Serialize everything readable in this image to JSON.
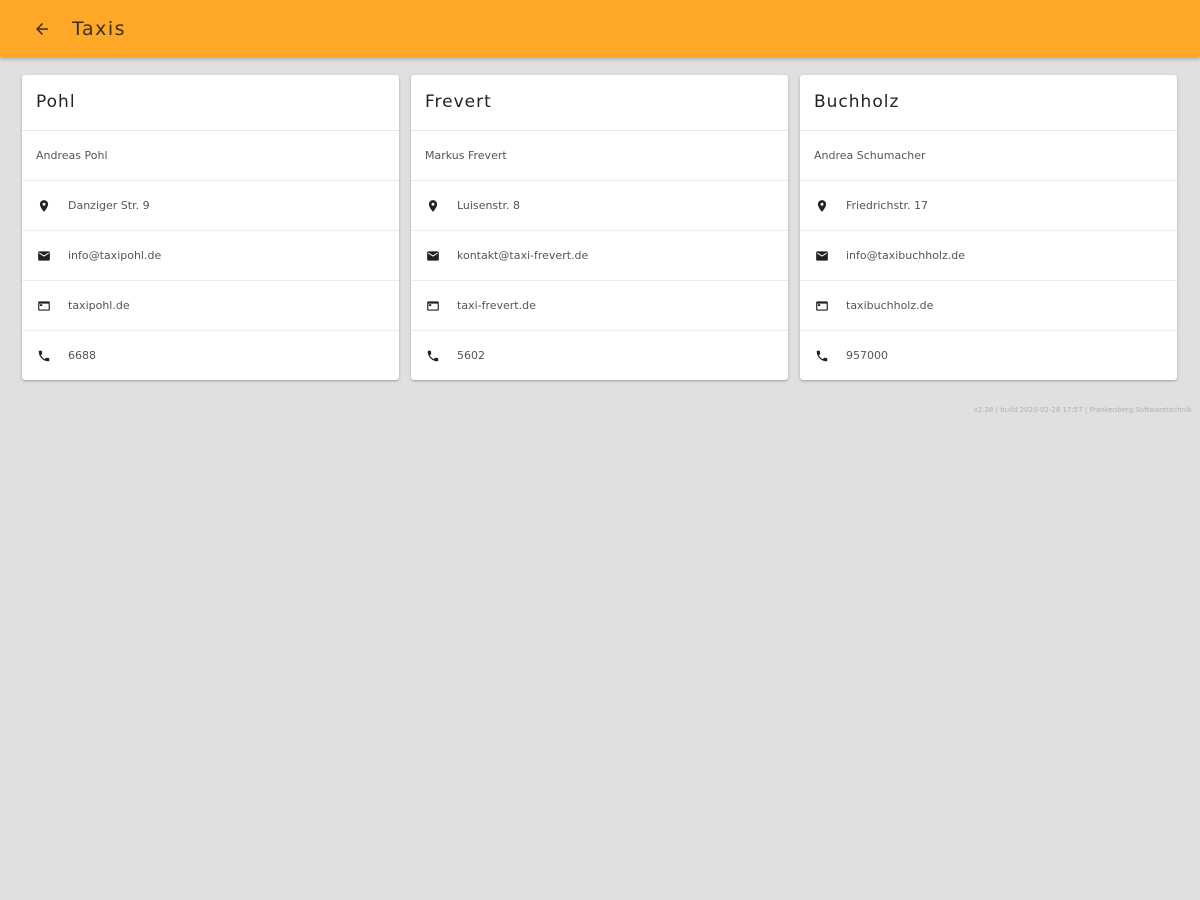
{
  "app_bar": {
    "title": "Taxis",
    "back_icon": "arrow-back-icon",
    "color": "#ffa726"
  },
  "taxis": [
    {
      "name": "Pohl",
      "owner": "Andreas Pohl",
      "address": "Danziger Str. 9",
      "email": "info@taxipohl.de",
      "website": "taxipohl.de",
      "phone": "6688"
    },
    {
      "name": "Frevert",
      "owner": "Markus Frevert",
      "address": "Luisenstr. 8",
      "email": "kontakt@taxi-frevert.de",
      "website": "taxi-frevert.de",
      "phone": "5602"
    },
    {
      "name": "Buchholz",
      "owner": "Andrea Schumacher",
      "address": "Friedrichstr. 17",
      "email": "info@taxibuchholz.de",
      "website": "taxibuchholz.de",
      "phone": "957000"
    }
  ],
  "icons": {
    "address": "location-pin-icon",
    "email": "email-icon",
    "website": "web-icon",
    "phone": "phone-icon"
  },
  "footer": {
    "text": "v2.28 | build 2020-02-28 17:57 | Frankenberg Softwaretechnik"
  }
}
